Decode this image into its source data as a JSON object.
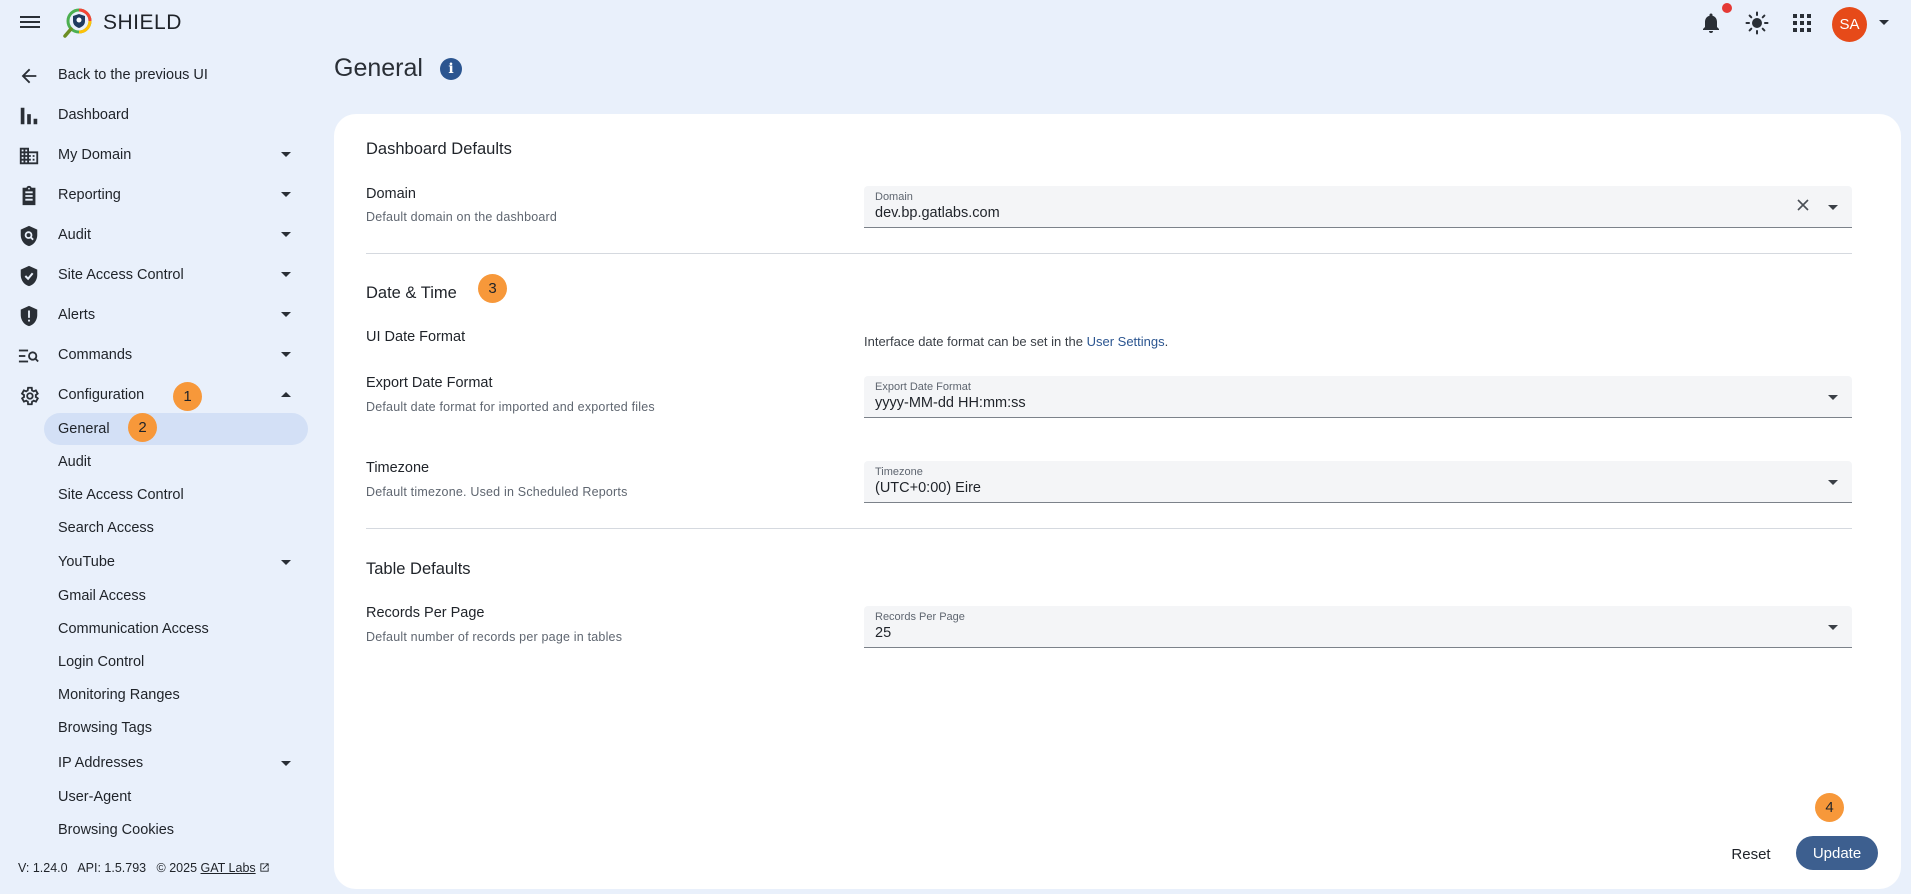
{
  "app": {
    "brand": "SHIELD",
    "avatar_initials": "SA"
  },
  "colors": {
    "accent": "#3d5f8f",
    "badge": "#f7983a",
    "avatar": "#e64a19",
    "notification": "#e53935",
    "active_nav": "#d3e0f6"
  },
  "sidebar": {
    "back": "Back to the previous UI",
    "items": [
      {
        "label": "Dashboard",
        "icon": "bar-chart-icon"
      },
      {
        "label": "My Domain",
        "icon": "building-icon"
      },
      {
        "label": "Reporting",
        "icon": "clipboard-icon"
      },
      {
        "label": "Audit",
        "icon": "shield-search-icon"
      },
      {
        "label": "Site Access Control",
        "icon": "shield-check-icon"
      },
      {
        "label": "Alerts",
        "icon": "shield-alert-icon"
      },
      {
        "label": "Commands",
        "icon": "commands-icon"
      },
      {
        "label": "Configuration",
        "icon": "gear-icon"
      }
    ],
    "sub_items": [
      "General",
      "Audit",
      "Site Access Control",
      "Search Access",
      "YouTube",
      "Gmail Access",
      "Communication Access",
      "Login Control",
      "Monitoring Ranges",
      "Browsing Tags",
      "IP Addresses",
      "User-Agent",
      "Browsing Cookies"
    ],
    "footer": {
      "version": "V: 1.24.0",
      "api": "API: 1.5.793",
      "copyright": "© 2025",
      "link": "GAT Labs"
    }
  },
  "badges": [
    "1",
    "2",
    "3",
    "4"
  ],
  "main": {
    "title": "General",
    "sections": {
      "dashboard": {
        "title": "Dashboard Defaults",
        "domain": {
          "label": "Domain",
          "desc": "Default domain on the dashboard",
          "field_label": "Domain",
          "value": "dev.bp.gatlabs.com"
        }
      },
      "datetime": {
        "title": "Date & Time",
        "ui_format": {
          "label": "UI Date Format",
          "hint_prefix": "Interface date format can be set in the",
          "hint_link": "User Settings",
          "hint_suffix": "."
        },
        "export_format": {
          "label": "Export Date Format",
          "desc": "Default date format for imported and exported files",
          "field_label": "Export Date Format",
          "value": "yyyy-MM-dd HH:mm:ss"
        },
        "timezone": {
          "label": "Timezone",
          "desc": "Default timezone. Used in Scheduled Reports",
          "field_label": "Timezone",
          "value": "(UTC+0:00) Eire"
        }
      },
      "table": {
        "title": "Table Defaults",
        "records": {
          "label": "Records Per Page",
          "desc": "Default number of records per page in tables",
          "field_label": "Records Per Page",
          "value": "25"
        }
      }
    },
    "buttons": {
      "reset": "Reset",
      "update": "Update"
    }
  }
}
